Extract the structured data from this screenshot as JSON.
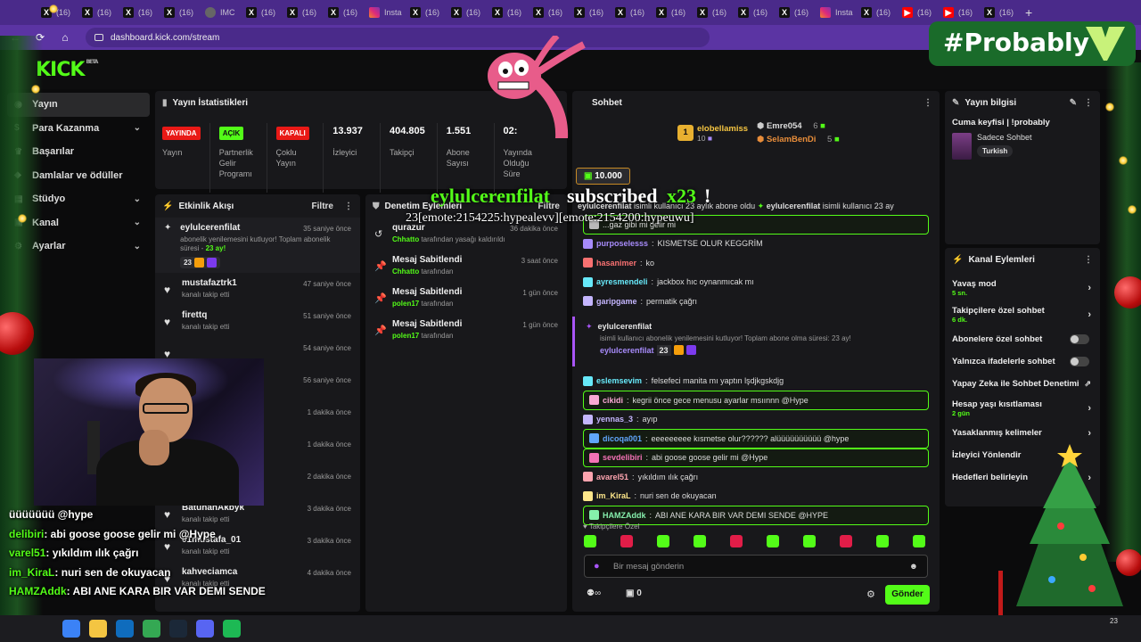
{
  "browser": {
    "tabs": [
      {
        "icon": "x-icon",
        "label": "(16)"
      },
      {
        "icon": "x-icon",
        "label": "(16)"
      },
      {
        "icon": "x-icon",
        "label": "(16)"
      },
      {
        "icon": "x-icon",
        "label": "(16)"
      },
      {
        "icon": "image-icon",
        "label": "IMC"
      },
      {
        "icon": "x-icon",
        "label": "(16)"
      },
      {
        "icon": "x-icon",
        "label": "(16)"
      },
      {
        "icon": "x-icon",
        "label": "(16)"
      },
      {
        "icon": "instagram-icon",
        "label": "Insta"
      },
      {
        "icon": "x-icon",
        "label": "(16)"
      },
      {
        "icon": "x-icon",
        "label": "(16)"
      },
      {
        "icon": "x-icon",
        "label": "(16)"
      },
      {
        "icon": "x-icon",
        "label": "(16)"
      },
      {
        "icon": "x-icon",
        "label": "(16)"
      },
      {
        "icon": "x-icon",
        "label": "(16)"
      },
      {
        "icon": "x-icon",
        "label": "(16)"
      },
      {
        "icon": "x-icon",
        "label": "(16)"
      },
      {
        "icon": "x-icon",
        "label": "(16)"
      },
      {
        "icon": "x-icon",
        "label": "(16)"
      },
      {
        "icon": "instagram-icon",
        "label": "Insta"
      },
      {
        "icon": "x-icon",
        "label": "(16)"
      },
      {
        "icon": "youtube-icon",
        "label": "(16)"
      },
      {
        "icon": "youtube-icon",
        "label": "(16)"
      },
      {
        "icon": "x-icon",
        "label": "(16)"
      }
    ],
    "url": "dashboard.kick.com/stream",
    "new_tab": "+"
  },
  "brand": {
    "logo": "KICK",
    "beta": "BETA",
    "accent": "#53fc18"
  },
  "sidebar": {
    "items": [
      {
        "label": "Yayın",
        "icon": "broadcast-icon",
        "active": true,
        "chev": ""
      },
      {
        "label": "Para Kazanma",
        "icon": "money-icon",
        "chev": "⌄"
      },
      {
        "label": "Başarılar",
        "icon": "trophy-icon",
        "chev": ""
      },
      {
        "label": "Damlalar ve ödüller",
        "icon": "drop-icon",
        "chev": ""
      },
      {
        "label": "Stüdyo",
        "icon": "studio-icon",
        "chev": "⌄"
      },
      {
        "label": "Kanal",
        "icon": "channel-icon",
        "chev": "⌄"
      },
      {
        "label": "Ayarlar",
        "icon": "gear-icon",
        "chev": "⌄"
      }
    ]
  },
  "stats_panel": {
    "title": "Yayın İstatistikleri",
    "items": [
      {
        "badge": "YAYINDA",
        "badge_color": "red",
        "label": "Yayın"
      },
      {
        "badge": "AÇIK",
        "badge_color": "green",
        "label": "Partnerlik Gelir Programı"
      },
      {
        "badge": "KAPALI",
        "badge_color": "red",
        "label": "Çoklu Yayın"
      },
      {
        "value": "13.937",
        "label": "İzleyici"
      },
      {
        "value": "404.805",
        "label": "Takipçi"
      },
      {
        "value": "1.551",
        "label": "Abone Sayısı"
      },
      {
        "value": "02:",
        "label": "Yayında Olduğu Süre"
      }
    ]
  },
  "activity": {
    "title": "Etkinlik Akışı",
    "filter": "Filtre",
    "sub_event": {
      "user": "eylulcerenfilat",
      "text": "abonelik yenilemesini kutluyor! Toplam abonelik süresi - ",
      "months": "23 ay!",
      "count": "23",
      "time": "35 saniye önce"
    },
    "follows": [
      {
        "user": "mustafaztrk1",
        "text": "kanalı takip etti",
        "time": "47 saniye önce"
      },
      {
        "user": "firettq",
        "text": "kanalı takip etti",
        "time": "51 saniye önce"
      },
      {
        "user": "",
        "text": "",
        "time": "54 saniye önce"
      },
      {
        "user": "",
        "text": "",
        "time": "56 saniye önce"
      },
      {
        "user": "",
        "text": "",
        "time": "1 dakika önce"
      },
      {
        "user": "",
        "text": "",
        "time": "1 dakika önce"
      },
      {
        "user": "",
        "text": "",
        "time": "2 dakika önce"
      },
      {
        "user": "BatuhanAkbyk",
        "text": "kanalı takip etti",
        "time": "3 dakika önce"
      },
      {
        "user": "01mustafa_01",
        "text": "kanalı takip etti",
        "time": "3 dakika önce"
      },
      {
        "user": "kahveciamca",
        "text": "kanalı takip etti",
        "time": "4 dakika önce"
      }
    ]
  },
  "moderation": {
    "title": "Denetim Eylemleri",
    "filter": "Filtre",
    "items": [
      {
        "icon": "undo-icon",
        "title": "qurazur",
        "by": "Chhatto",
        "action": "tarafından yasağı kaldırıldı",
        "time": "36 dakika önce"
      },
      {
        "icon": "pin-icon",
        "title": "Mesaj Sabitlendi",
        "by": "Chhatto",
        "action": "tarafından",
        "time": "3 saat önce"
      },
      {
        "icon": "pin-icon",
        "title": "Mesaj Sabitlendi",
        "by": "polen17",
        "action": "tarafından",
        "time": "1 gün önce"
      },
      {
        "icon": "pin-icon",
        "title": "Mesaj Sabitlendi",
        "by": "polen17",
        "action": "tarafından",
        "time": "1 gün önce"
      }
    ]
  },
  "chat": {
    "title": "Sohbet",
    "top_gifters": [
      {
        "rank": "1",
        "user": "elobellamiss",
        "amount": "10"
      },
      {
        "user": "Emre054",
        "amount": "6"
      },
      {
        "user": "SelamBenDi",
        "amount": "5"
      }
    ],
    "kicks": "10.000",
    "pinned_user": "eylulcerenfilat",
    "pinned_text": "isimli kullanıcı 23 aylık abone oldu",
    "pinned_user2": "eylulcerenfilat",
    "pinned_text2": "isimli kullanıcı 23 ay",
    "messages": [
      {
        "user": "",
        "color": "#b9b9b9",
        "text": "...gaz gibi mi gelir mi",
        "hl": true
      },
      {
        "user": "purposelesss",
        "color": "#a78bfa",
        "text": "KISMETSE OLUR KEGGRİM"
      },
      {
        "user": "hasanimer",
        "color": "#f87171",
        "text": "ko"
      },
      {
        "user": "ayresmendeli",
        "color": "#67e8f9",
        "text": "jackbox hıc oynanmıcak mı"
      },
      {
        "user": "garipgame",
        "color": "#c4b5fd",
        "text": "permatik çağrı"
      }
    ],
    "sub_msg": {
      "user": "eylulcerenfilat",
      "text": "isimli kullanıcı abonelik yenilemesini kutluyor! Toplam abone olma süresi: 23 ay!",
      "user2": "eylulcerenfilat",
      "count": "23"
    },
    "messages2": [
      {
        "user": "eslemsevim",
        "color": "#67e8f9",
        "text": "felsefeci manita mı yaptın lşdjkgskdjg"
      },
      {
        "user": "cikidi",
        "color": "#f9a8d4",
        "text": "kegrii önce gece menusu ayarlar msıınnn @Hype",
        "hl": true
      },
      {
        "user": "yennas_3",
        "color": "#c4b5fd",
        "text": "ayıp"
      },
      {
        "user": "dicoqa001",
        "color": "#60a5fa",
        "text": "eeeeeeeee kısmetse olur?????? alüüüüüüüüüü @hype",
        "hl": true
      },
      {
        "user": "sevdelibiri",
        "color": "#f472b6",
        "text": "abi goose goose gelir mi @Hype",
        "hl": true
      },
      {
        "user": "avarel51",
        "color": "#fda4af",
        "text": "yıkıldım ılık çağrı"
      },
      {
        "user": "im_KiraL",
        "color": "#fde68a",
        "text": "nuri sen de okuyacan"
      },
      {
        "user": "HAMZAddk",
        "color": "#86efac",
        "text": "ABI ANE KARA BIR VAR DEMI SENDE @HYPE",
        "hl": true
      }
    ],
    "followers_only": "Takipçilere Özel",
    "input_placeholder": "Bir mesaj gönderin",
    "points": "0",
    "send": "Gönder"
  },
  "stream_info": {
    "title": "Yayın bilgisi",
    "stream_title": "Cuma keyfisi | !probably",
    "category": "Sadece Sohbet",
    "tag": "Turkish"
  },
  "channel_actions": {
    "title": "Kanal Eylemleri",
    "items": [
      {
        "label": "Yavaş mod",
        "sub": "5 sn.",
        "type": "chevron"
      },
      {
        "label": "Takipçilere özel sohbet",
        "sub": "6 dk.",
        "type": "chevron"
      },
      {
        "label": "Abonelere özel sohbet",
        "type": "toggle"
      },
      {
        "label": "Yalnızca ifadelerle sohbet",
        "type": "toggle"
      },
      {
        "label": "Yapay Zeka ile Sohbet Denetimi",
        "type": "external"
      },
      {
        "label": "Hesap yaşı kısıtlaması",
        "sub": "2 gün",
        "type": "chevron"
      },
      {
        "label": "Yasaklanmış kelimeler",
        "type": "chevron"
      },
      {
        "label": "İzleyici Yönlendir",
        "type": "none"
      },
      {
        "label": "Hedefleri belirleyin",
        "type": "chevron"
      }
    ]
  },
  "overlay": {
    "alert_name": "eylulcerenfilat",
    "alert_sub": "subscribed",
    "alert_x": "x23",
    "alert_excl": "!",
    "alert_msg": "23[emote:2154225:hypealevv][emote:2154200:hypeuwu]",
    "brand_tag": "#Probably",
    "chat": [
      {
        "user": "",
        "text": "üüüüüüü @hype"
      },
      {
        "user": "delibiri",
        "text": ": abi goose goose gelir mi @Hype"
      },
      {
        "user": "varel51",
        "text": ": yıkıldım ılık çağrı"
      },
      {
        "user": "im_KiraL",
        "text": ": nuri sen de okuyacan"
      },
      {
        "user": "HAMZAddk",
        "text": ": ABI ANE KARA BIR VAR DEMI SENDE"
      }
    ]
  },
  "taskbar": {
    "apps": [
      "windows-icon",
      "explorer-icon",
      "outlook-icon",
      "chrome-icon",
      "steam-icon",
      "discord-icon",
      "spotify-icon"
    ],
    "clock": "23"
  }
}
